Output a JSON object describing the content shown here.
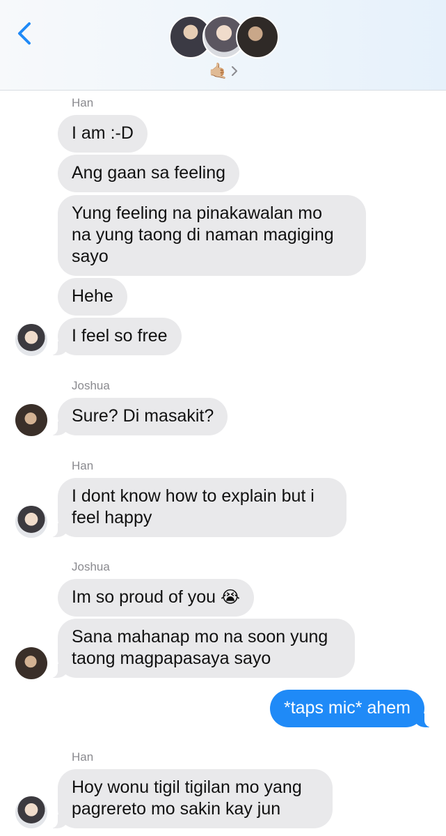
{
  "header": {
    "back_icon": "chevron-left-icon",
    "group_avatars": [
      "avatar-1",
      "avatar-2",
      "avatar-3"
    ],
    "reaction_emoji": "🤙🏼",
    "disclosure_icon": "chevron-right-icon",
    "accent_color": "#1f8af7"
  },
  "messages": {
    "sender_han_1": "Han",
    "m1": "I am :-D",
    "m2": "Ang gaan sa feeling",
    "m3_line1": "Yung feeling na pinakawalan mo",
    "m3_line2": "na yung taong di naman magiging",
    "m3_line3": "sayo",
    "m4": "Hehe",
    "m5": "I feel so free",
    "sender_joshua_1": "Joshua",
    "m6": "Sure? Di masakit?",
    "sender_han_2": "Han",
    "m7_line1": "I dont know how to explain but i",
    "m7_line2": "feel happy",
    "sender_joshua_2": "Joshua",
    "m8_text": "Im so proud of you",
    "m8_emoji": "😭",
    "m9_line1": "Sana mahanap mo na soon yung",
    "m9_line2": "taong magpapasaya sayo",
    "m10": "*taps mic* ahem",
    "sender_han_3": "Han",
    "m11_line1": "Hoy wonu tigil tigilan mo yang",
    "m11_line2": "pagrereto mo sakin kay jun"
  },
  "colors": {
    "incoming_bubble": "#e9e9eb",
    "outgoing_bubble": "#1f8af7",
    "sender_label": "#8a8a8f"
  }
}
